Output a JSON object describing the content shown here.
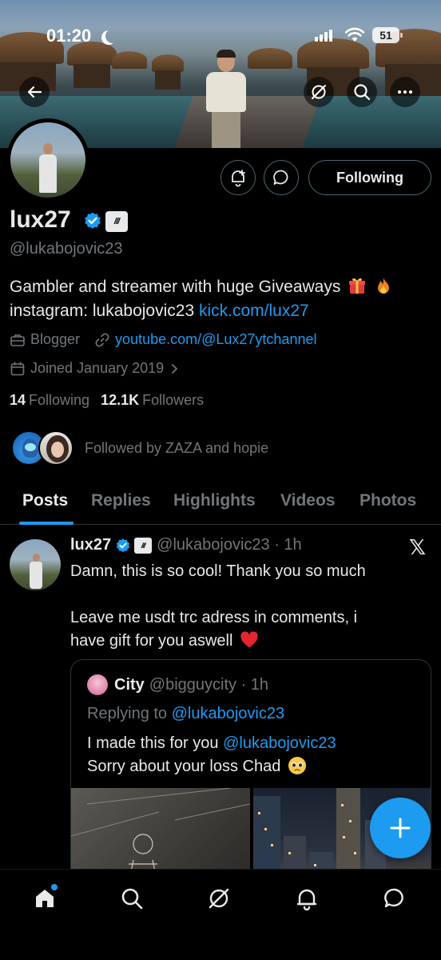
{
  "status_bar": {
    "time": "01:20",
    "battery": "51"
  },
  "profile": {
    "name": "lux27",
    "handle": "@lukabojovic23",
    "bio_line1": "Gambler and streamer with huge Giveaways",
    "bio_line2_prefix": "instagram: lukabojovic23",
    "bio_link": "kick.com/lux27",
    "category": "Blogger",
    "website": "youtube.com/@Lux27ytchannel",
    "joined": "Joined January 2019",
    "following_count": "14",
    "following_label": "Following",
    "followers_count": "12.1K",
    "followers_label": "Followers",
    "followed_by": "Followed by ZAZA and hopie",
    "follow_button_label": "Following"
  },
  "tabs": [
    "Posts",
    "Replies",
    "Highlights",
    "Videos",
    "Photos"
  ],
  "post": {
    "name": "lux27",
    "handle_time": "@lukabojovic23 · 1h",
    "text_line1": "Damn, this is so cool! Thank you so much",
    "text_line2": "Leave me usdt trc adress in comments, i",
    "text_line3": "have gift for you aswell",
    "quote": {
      "name": "City",
      "handle_time": "@bigguycity · 1h",
      "replying_prefix": "Replying to",
      "replying_handle": "@lukabojovic23",
      "text_line1_prefix": "I made this for you",
      "text_line1_mention": "@lukabojovic23",
      "text_line2": "Sorry about your loss Chad"
    }
  },
  "colors": {
    "accent": "#1d9bf0",
    "background": "#000000",
    "text_primary": "#e7e9ea",
    "text_secondary": "#71767b",
    "border": "#2f3336"
  },
  "icons": {
    "back": "arrow-left-icon",
    "grok": "grok-icon",
    "search": "search-icon",
    "more": "more-icon",
    "notify": "bell-plus-icon",
    "message": "message-icon",
    "verified": "verified-icon",
    "compose": "plus-icon",
    "nav": [
      "home-icon",
      "search-icon",
      "grok-icon",
      "notifications-icon",
      "messages-icon"
    ]
  }
}
